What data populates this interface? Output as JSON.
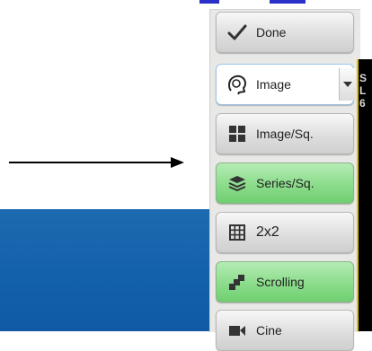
{
  "colors": {
    "accent_blue": "#2b2fc9",
    "panel_blue": "#1461ab",
    "green_button": "#8cdc8c",
    "viewer_border": "#e2c000"
  },
  "toolbar": {
    "buttons": [
      {
        "label": "Done",
        "icon": "checkmark-icon",
        "style": "gray"
      },
      {
        "label": "Image",
        "icon": "head-icon",
        "style": "active"
      },
      {
        "label": "Image/Sq.",
        "icon": "four-squares-icon",
        "style": "gray"
      },
      {
        "label": "Series/Sq.",
        "icon": "layers-icon",
        "style": "green"
      },
      {
        "label": "2x2",
        "icon": "grid-icon",
        "style": "gray"
      },
      {
        "label": "Scrolling",
        "icon": "stacked-frames-icon",
        "style": "green"
      },
      {
        "label": "Cine",
        "icon": "camera-icon",
        "style": "gray"
      }
    ]
  },
  "viewer": {
    "overlay_lines": [
      "S",
      "L",
      "6"
    ]
  }
}
